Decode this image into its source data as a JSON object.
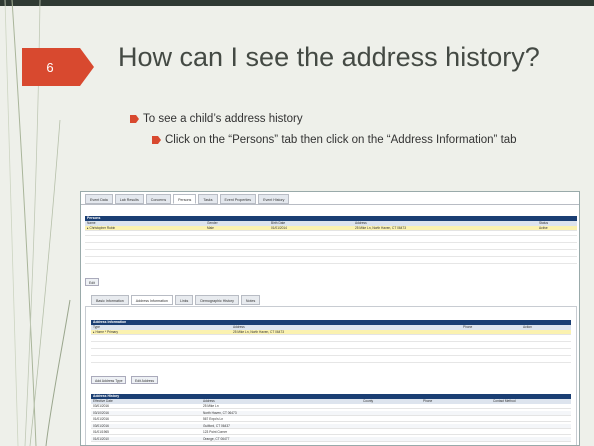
{
  "slide": {
    "number": "6",
    "title": "How can I see the address history?",
    "bullet_1": "To see a child’s address history",
    "bullet_2": "Click on the “Persons” tab then click on the “Address Information” tab"
  },
  "colors": {
    "number_tab": "#d8492f",
    "grid_header": "#1a3e73",
    "selected_row": "#fbf2b0"
  },
  "screenshot": {
    "tabs": [
      "Event Data",
      "Lab Results",
      "Concerns",
      "Persons",
      "Tasks",
      "Event Properties",
      "Event History"
    ],
    "persons_header": "Persons",
    "persons_columns": [
      "Name",
      "Gender",
      "Birth Date",
      "Address",
      "Status"
    ],
    "persons_row": [
      "▸ Christopher Rubin",
      "Male",
      "01/01/2014",
      "25 Mike Ln, North Haven, CT 06473",
      "Active"
    ],
    "edit_label": "Edit",
    "subtabs": [
      "Basic Information",
      "Address Information",
      "Links",
      "Demographic History",
      "Notes"
    ],
    "address_info_header": "Address Information",
    "address_info_columns": [
      "Type",
      "Address",
      "Phone",
      "Action"
    ],
    "address_info_row": [
      "▸ Home * Primary",
      "25 Mike Ln, North Haven, CT 06473",
      "",
      ""
    ],
    "add_address_type_label": "Add Address Type",
    "edit_address_label": "Edit Address",
    "address_history_header": "Address History",
    "address_history_columns": [
      "Effective Date",
      "Address",
      "County",
      "Phone",
      "Contact Method"
    ],
    "address_history_rows": [
      [
        "03/01/2016",
        "25 Mike Ln",
        "",
        "",
        ""
      ],
      [
        "03/10/2016",
        "North Haven, CT 06473",
        "",
        "",
        ""
      ],
      [
        "01/01/2016",
        "567 Expo's Ln",
        "",
        "",
        ""
      ],
      [
        "03/01/2016",
        "Guilford, CT 06437",
        "",
        "",
        ""
      ],
      [
        "01/01/1965",
        "123 Point Corner",
        "",
        "",
        ""
      ],
      [
        "01/01/2010",
        "Orange, CT 06477",
        "",
        "",
        ""
      ]
    ]
  }
}
